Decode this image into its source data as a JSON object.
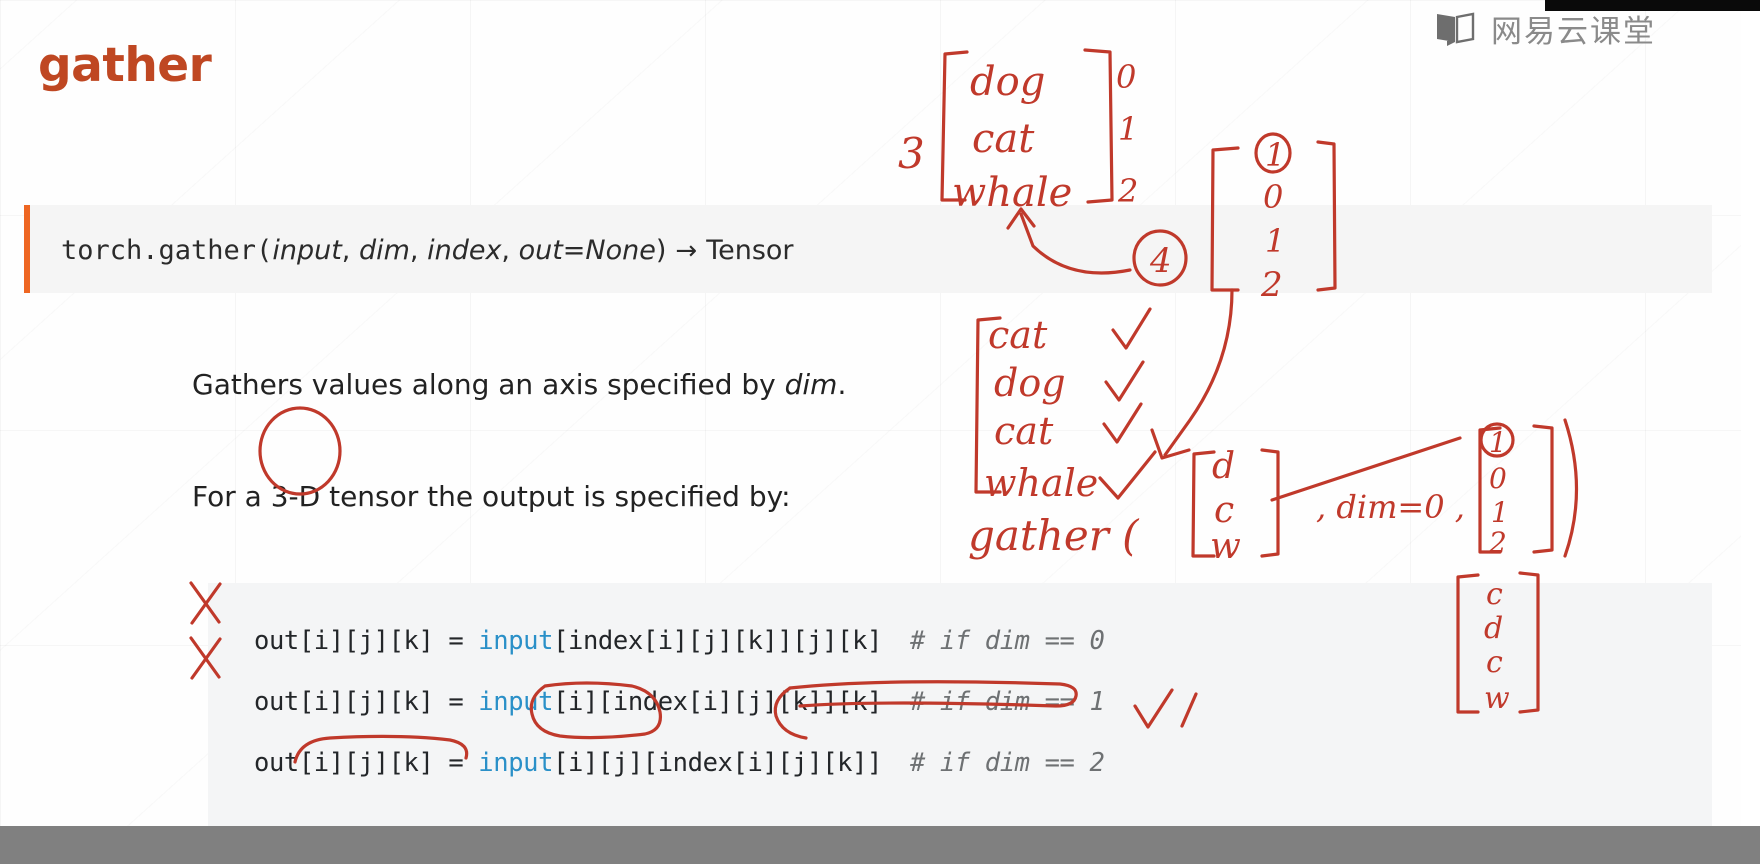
{
  "brand": {
    "logo_icon": "open-book-icon",
    "name": "网易云课堂"
  },
  "slide": {
    "title": "gather",
    "title_color": "#bf4722",
    "accent_bar_color": "#ee6622",
    "signature": {
      "module": "torch.gather(",
      "arg1": "input",
      "sep1": ", ",
      "arg2": "dim",
      "sep2": ", ",
      "arg3": "index",
      "sep3": ", ",
      "arg4": "out=None",
      "close": ")",
      "arrow": "→",
      "returns": "Tensor",
      "full_text": "torch.gather(input, dim, index, out=None) → Tensor"
    },
    "paragraphs": [
      {
        "before": "Gathers values along an axis specified by ",
        "emph": "dim",
        "after": "."
      },
      {
        "before": "For a 3-D tensor the output is specified by:",
        "emph": "",
        "after": ""
      }
    ],
    "code_lines": [
      {
        "lhs": "out[i][j][k] = ",
        "fn": "input",
        "rhs": "[index[i][j][k]][j][k]",
        "comment": "# if dim == 0"
      },
      {
        "lhs": "out[i][j][k] = ",
        "fn": "input",
        "rhs": "[i][index[i][j][k]][k]",
        "comment": "# if dim == 1"
      },
      {
        "lhs": "out[i][j][k] = ",
        "fn": "input",
        "rhs": "[i][j][index[i][j][k]]",
        "comment": "# if dim == 2"
      }
    ]
  },
  "annotations": {
    "count_label": "3",
    "source_matrix": [
      "dog",
      "cat",
      "whale"
    ],
    "source_indices": [
      "0",
      "1",
      "2"
    ],
    "result_count": "4",
    "index_matrix_top": [
      "1",
      "0",
      "1",
      "2"
    ],
    "gathered_matrix": [
      "cat",
      "dog",
      "cat",
      "whale"
    ],
    "gathered_checks": [
      "✓",
      "✓",
      "✓",
      "✓"
    ],
    "gather_call_label": "gather (",
    "gather_input_matrix": [
      "d",
      "c",
      "w"
    ],
    "gather_dim_label": ", dim=0 ,",
    "gather_index_matrix": [
      "1",
      "0",
      "1",
      "2"
    ],
    "gather_close": ")",
    "gather_output_matrix": [
      "c",
      "d",
      "c",
      "w"
    ],
    "ink_color": "#c0392b",
    "cross_marks": [
      "✕",
      "✕"
    ],
    "final_check": "✓"
  },
  "player": {
    "bottom_bar_color": "#808080"
  }
}
